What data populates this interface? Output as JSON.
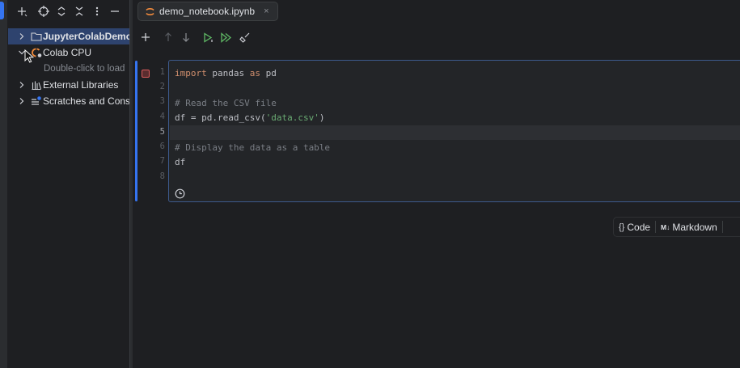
{
  "project_panel": {
    "toolbar_icons": [
      "add-icon",
      "locate-icon",
      "expand-all-icon",
      "collapse-all-icon",
      "more-options-icon",
      "minimize-icon"
    ],
    "tree": [
      {
        "label": "JupyterColabDemo",
        "icon": "folder-icon",
        "expanded": false,
        "selected": true
      },
      {
        "label": "Colab CPU",
        "icon": "colab-server-icon",
        "expanded": true,
        "selected": false
      },
      {
        "label": "Double-click to load",
        "icon": "",
        "hint": true
      },
      {
        "label": "External Libraries",
        "icon": "libraries-icon",
        "expanded": false
      },
      {
        "label": "Scratches and Consoles",
        "icon": "scratches-icon",
        "expanded": false
      }
    ]
  },
  "editor": {
    "tab": {
      "label": "demo_notebook.ipynb",
      "icon": "jupyter-icon",
      "close": "×"
    },
    "toolbar_icons": [
      "add-cell-icon",
      "move-up-icon",
      "move-down-icon",
      "run-cell-icon",
      "run-all-icon",
      "clear-outputs-icon"
    ],
    "line_numbers": [
      "1",
      "2",
      "3",
      "4",
      "5",
      "6",
      "7",
      "8"
    ],
    "current_line": "5",
    "code": {
      "l1_kw1": "import",
      "l1_mid": " pandas ",
      "l1_kw2": "as",
      "l1_end": " pd",
      "l3": "# Read the CSV file",
      "l4_pre": "df = pd.read_csv(",
      "l4_str": "'data.csv'",
      "l4_post": ")",
      "l6": "# Display the data as a table",
      "l7": "df"
    },
    "add_cell": {
      "code_label": "Code",
      "code_icon": "{}",
      "markdown_badge": "M↓",
      "markdown_label": "Markdown"
    }
  },
  "colors": {
    "accent": "#3574f0",
    "selection": "#2e436e",
    "keyword": "#cf8e6d",
    "string": "#6aab73",
    "comment": "#7a7e85",
    "run_green": "#5fb865"
  }
}
